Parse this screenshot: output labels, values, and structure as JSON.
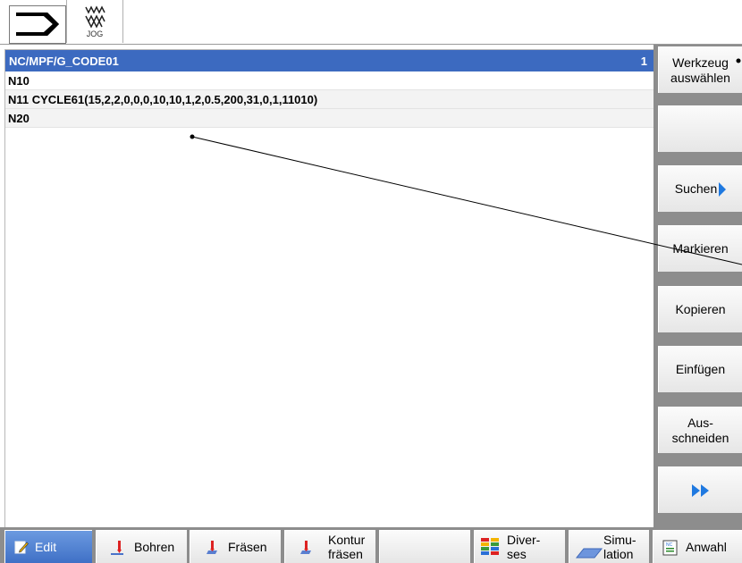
{
  "topbar": {
    "jog_label": "JOG"
  },
  "editor": {
    "path": "NC/MPF/G_CODE01",
    "line_indicator": "1",
    "lines": [
      "N10",
      "N11 CYCLE61(15,2,2,0,0,0,10,10,1,2,0.5,200,31,0,1,11010)",
      "N20"
    ]
  },
  "vertical_softkeys": [
    {
      "line1": "Werkzeug",
      "line2": "auswählen"
    },
    {
      "line1": "",
      "line2": ""
    },
    {
      "label": "Suchen"
    },
    {
      "label": "Markieren"
    },
    {
      "label": "Kopieren"
    },
    {
      "label": "Einfügen"
    },
    {
      "line1": "Aus-",
      "line2": "schneiden"
    },
    {
      "label": "▸▸"
    }
  ],
  "horizontal_softkeys": [
    {
      "label": "Edit"
    },
    {
      "label": "Bohren"
    },
    {
      "label": "Fräsen"
    },
    {
      "line1": "Kontur",
      "line2": "fräsen"
    },
    {
      "label": ""
    },
    {
      "line1": "Diver-",
      "line2": "ses"
    },
    {
      "line1": "Simu-",
      "line2": "lation"
    },
    {
      "label": "Anwahl"
    }
  ],
  "colors": {
    "header_bg": "#3c6ac0",
    "softkey_bar": "#8d8d8d",
    "accent_arrow": "#1f79e0"
  }
}
